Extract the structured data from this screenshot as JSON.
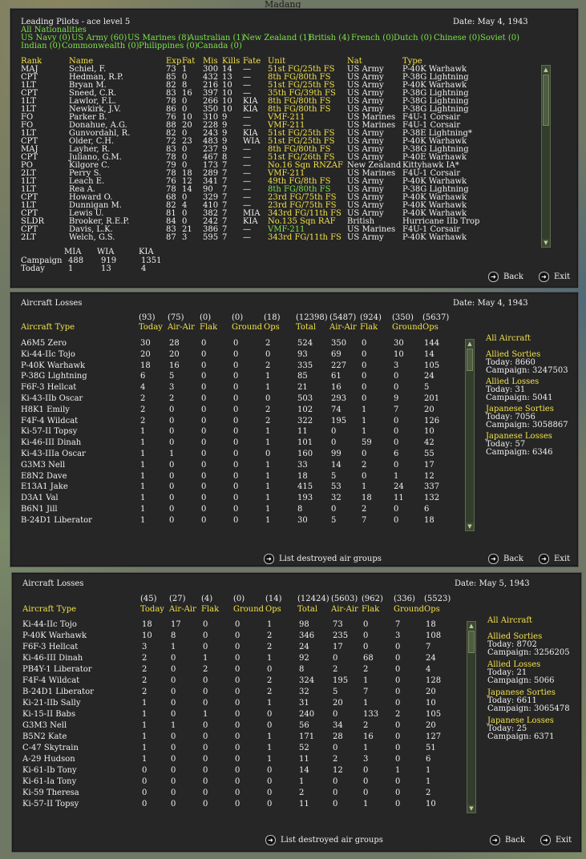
{
  "map_label": "Madang",
  "pilots": {
    "title": "Leading Pilots - ace level 5",
    "date": "Date: May 4, 1943",
    "all_nat": "All Nationalities",
    "filters1": [
      "US Navy (0)",
      "US Army (60)",
      "US Marines (8)",
      "Australian (1)",
      "New Zealand (1)",
      "British (4)",
      "French (0)",
      "Dutch (0)",
      "Chinese (0)",
      "Soviet (0)"
    ],
    "filters2": [
      "Indian (0)",
      "Commonwealth (0)",
      "Philippines (0)",
      "Canada (0)"
    ],
    "headers": [
      "Rank",
      "Name",
      "Exp",
      "Fat",
      "Mis",
      "Kills",
      "Fate",
      "Unit",
      "Nat",
      "Type"
    ],
    "rows": [
      [
        "MAJ",
        "Schiel, F.",
        "73",
        "1",
        "300",
        "14",
        "—",
        "51st FG/25th FS",
        "US Army",
        "P-40K Warhawk",
        "y"
      ],
      [
        "CPT",
        "Hedman, R.P.",
        "85",
        "0",
        "432",
        "13",
        "—",
        "8th FG/80th FS",
        "US Army",
        "P-38G Lightning",
        "y"
      ],
      [
        "1LT",
        "Bryan M.",
        "82",
        "8",
        "216",
        "10",
        "—",
        "51st FG/25th FS",
        "US Army",
        "P-40K Warhawk",
        "y"
      ],
      [
        "CPT",
        "Sneed, C.R.",
        "83",
        "16",
        "397",
        "10",
        "—",
        "35th FG/39th FS",
        "US Army",
        "P-38G Lightning",
        "y"
      ],
      [
        "1LT",
        "Lawlor, F.L.",
        "78",
        "0",
        "266",
        "10",
        "KIA",
        "8th FG/80th FS",
        "US Army",
        "P-38G Lightning",
        "y"
      ],
      [
        "1LT",
        "Newkirk, J.V.",
        "86",
        "0",
        "350",
        "10",
        "KIA",
        "8th FG/80th FS",
        "US Army",
        "P-38G Lightning",
        "y"
      ],
      [
        "FO",
        "Parker B.",
        "76",
        "10",
        "310",
        "9",
        "—",
        "VMF-211",
        "US Marines",
        "F4U-1 Corsair",
        "y"
      ],
      [
        "FO",
        "Donahue, A.G.",
        "88",
        "20",
        "228",
        "9",
        "—",
        "VMF-211",
        "US Marines",
        "F4U-1 Corsair",
        "y"
      ],
      [
        "1LT",
        "Gunvordahl, R.",
        "82",
        "0",
        "243",
        "9",
        "KIA",
        "51st FG/25th FS",
        "US Army",
        "P-38E Lightning*",
        "y"
      ],
      [
        "CPT",
        "Older, C.H.",
        "72",
        "23",
        "483",
        "9",
        "WIA",
        "51st FG/25th FS",
        "US Army",
        "P-40K Warhawk",
        "y"
      ],
      [
        "MAJ",
        "Layher, R.",
        "83",
        "0",
        "237",
        "9",
        "—",
        "8th FG/80th FS",
        "US Army",
        "P-38G Lightning",
        "y"
      ],
      [
        "CPT",
        "Juliano, G.M.",
        "78",
        "0",
        "467",
        "8",
        "—",
        "51st FG/26th FS",
        "US Army",
        "P-40E Warhawk",
        "y"
      ],
      [
        "PO",
        "Kilgore C.",
        "79",
        "0",
        "173",
        "7",
        "—",
        "No.16 Sqn RNZAF",
        "New Zealand",
        "Kittyhawk IA*",
        "y"
      ],
      [
        "2LT",
        "Perry S.",
        "78",
        "18",
        "289",
        "7",
        "—",
        "VMF-211",
        "US Marines",
        "F4U-1 Corsair",
        "y"
      ],
      [
        "1LT",
        "Leach E.",
        "76",
        "12",
        "341",
        "7",
        "—",
        "49th FG/8th FS",
        "US Army",
        "P-40K Warhawk",
        "y"
      ],
      [
        "1LT",
        "Rea A.",
        "78",
        "14",
        "90",
        "7",
        "—",
        "8th FG/80th FS",
        "US Army",
        "P-38G Lightning",
        "g"
      ],
      [
        "CPT",
        "Howard O.",
        "68",
        "0",
        "329",
        "7",
        "—",
        "23rd FG/75th FS",
        "US Army",
        "P-40K Warhawk",
        "y"
      ],
      [
        "1LT",
        "Dunnigan M.",
        "82",
        "4",
        "410",
        "7",
        "—",
        "23rd FG/75th FS",
        "US Army",
        "P-40K Warhawk",
        "y"
      ],
      [
        "CPT",
        "Lewis U.",
        "81",
        "0",
        "382",
        "7",
        "MIA",
        "343rd FG/11th FS",
        "US Army",
        "P-40K Warhawk",
        "y"
      ],
      [
        "SLDR",
        "Brooker, R.E.P.",
        "84",
        "0",
        "242",
        "7",
        "KIA",
        "No.135 Sqn RAF",
        "British",
        "Hurricane IIb Trop",
        "y"
      ],
      [
        "CPT",
        "Davis, L.K.",
        "83",
        "21",
        "386",
        "7",
        "—",
        "VMF-211",
        "US Marines",
        "F4U-1 Corsair",
        "g"
      ],
      [
        "2LT",
        "Welch, G.S.",
        "87",
        "3",
        "595",
        "7",
        "—",
        "343rd FG/11th FS",
        "US Army",
        "P-40K Warhawk",
        "y"
      ]
    ],
    "summary_headers": [
      "MIA",
      "WIA",
      "KIA"
    ],
    "summary_rows": [
      [
        "Campaign",
        "488",
        "919",
        "1351"
      ],
      [
        "Today",
        "1",
        "13",
        "4"
      ]
    ],
    "back": "Back",
    "exit": "Exit"
  },
  "losses1": {
    "title": "Aircraft Losses",
    "date": "Date: May 4, 1943",
    "totals": [
      "(93)",
      "(75)",
      "(0)",
      "(0)",
      "(18)",
      "(12398)",
      "(5487)",
      "(924)",
      "(350)",
      "(5637)"
    ],
    "type_header": "Aircraft Type",
    "headers": [
      "Today",
      "Air-Air",
      "Flak",
      "Ground",
      "Ops",
      "Total",
      "Air-Air",
      "Flak",
      "Ground",
      "Ops"
    ],
    "rows": [
      [
        "A6M5 Zero",
        "30",
        "28",
        "0",
        "0",
        "2",
        "524",
        "350",
        "0",
        "30",
        "144"
      ],
      [
        "Ki-44-IIc Tojo",
        "20",
        "20",
        "0",
        "0",
        "0",
        "93",
        "69",
        "0",
        "10",
        "14"
      ],
      [
        "P-40K Warhawk",
        "18",
        "16",
        "0",
        "0",
        "2",
        "335",
        "227",
        "0",
        "3",
        "105"
      ],
      [
        "P-38G Lightning",
        "6",
        "5",
        "0",
        "0",
        "1",
        "85",
        "61",
        "0",
        "0",
        "24"
      ],
      [
        "F6F-3 Hellcat",
        "4",
        "3",
        "0",
        "0",
        "1",
        "21",
        "16",
        "0",
        "0",
        "5"
      ],
      [
        "Ki-43-IIb Oscar",
        "2",
        "2",
        "0",
        "0",
        "0",
        "503",
        "293",
        "0",
        "9",
        "201"
      ],
      [
        "H8K1 Emily",
        "2",
        "0",
        "0",
        "0",
        "2",
        "102",
        "74",
        "1",
        "7",
        "20"
      ],
      [
        "F4F-4 Wildcat",
        "2",
        "0",
        "0",
        "0",
        "2",
        "322",
        "195",
        "1",
        "0",
        "126"
      ],
      [
        "Ki-57-II Topsy",
        "1",
        "0",
        "0",
        "0",
        "1",
        "11",
        "0",
        "1",
        "0",
        "10"
      ],
      [
        "Ki-46-III Dinah",
        "1",
        "0",
        "0",
        "0",
        "1",
        "101",
        "0",
        "59",
        "0",
        "42"
      ],
      [
        "Ki-43-IIIa Oscar",
        "1",
        "1",
        "0",
        "0",
        "0",
        "160",
        "99",
        "0",
        "6",
        "55"
      ],
      [
        "G3M3 Nell",
        "1",
        "0",
        "0",
        "0",
        "1",
        "33",
        "14",
        "2",
        "0",
        "17"
      ],
      [
        "E8N2 Dave",
        "1",
        "0",
        "0",
        "0",
        "1",
        "18",
        "5",
        "0",
        "1",
        "12"
      ],
      [
        "E13A1 Jake",
        "1",
        "0",
        "0",
        "0",
        "1",
        "415",
        "53",
        "1",
        "24",
        "337"
      ],
      [
        "D3A1 Val",
        "1",
        "0",
        "0",
        "0",
        "1",
        "193",
        "32",
        "18",
        "11",
        "132"
      ],
      [
        "B6N1 Jill",
        "1",
        "0",
        "0",
        "0",
        "1",
        "8",
        "0",
        "2",
        "0",
        "6"
      ],
      [
        "B-24D1 Liberator",
        "1",
        "0",
        "0",
        "0",
        "1",
        "30",
        "5",
        "7",
        "0",
        "18"
      ]
    ],
    "side": {
      "all": "All Aircraft",
      "blocks": [
        [
          "Allied Sorties",
          "Today:  8660",
          "Campaign: 3247503"
        ],
        [
          "Allied Losses",
          "Today:  31",
          "Campaign: 5041"
        ],
        [
          "Japanese Sorties",
          "Today:  7056",
          "Campaign: 3058867"
        ],
        [
          "Japanese Losses",
          "Today:  57",
          "Campaign: 6346"
        ]
      ]
    },
    "list_destroyed": "List destroyed air groups",
    "back": "Back",
    "exit": "Exit"
  },
  "losses2": {
    "title": "Aircraft Losses",
    "date": "Date: May 5, 1943",
    "totals": [
      "(45)",
      "(27)",
      "(4)",
      "(0)",
      "(14)",
      "(12424)",
      "(5603)",
      "(962)",
      "(336)",
      "(5523)"
    ],
    "type_header": "Aircraft Type",
    "headers": [
      "Today",
      "Air-Air",
      "Flak",
      "Ground",
      "Ops",
      "Total",
      "Air-Air",
      "Flak",
      "Ground",
      "Ops"
    ],
    "rows": [
      [
        "Ki-44-IIc Tojo",
        "18",
        "17",
        "0",
        "0",
        "1",
        "98",
        "73",
        "0",
        "7",
        "18"
      ],
      [
        "P-40K Warhawk",
        "10",
        "8",
        "0",
        "0",
        "2",
        "346",
        "235",
        "0",
        "3",
        "108"
      ],
      [
        "F6F-3 Hellcat",
        "3",
        "1",
        "0",
        "0",
        "2",
        "24",
        "17",
        "0",
        "0",
        "7"
      ],
      [
        "Ki-46-III Dinah",
        "2",
        "0",
        "1",
        "0",
        "1",
        "92",
        "0",
        "68",
        "0",
        "24"
      ],
      [
        "PB4Y-1 Liberator",
        "2",
        "0",
        "2",
        "0",
        "0",
        "8",
        "2",
        "2",
        "0",
        "4"
      ],
      [
        "F4F-4 Wildcat",
        "2",
        "0",
        "0",
        "0",
        "2",
        "324",
        "195",
        "1",
        "0",
        "128"
      ],
      [
        "B-24D1 Liberator",
        "2",
        "0",
        "0",
        "0",
        "2",
        "32",
        "5",
        "7",
        "0",
        "20"
      ],
      [
        "Ki-21-IIb Sally",
        "1",
        "0",
        "0",
        "0",
        "1",
        "31",
        "20",
        "1",
        "0",
        "10"
      ],
      [
        "Ki-15-II Babs",
        "1",
        "0",
        "1",
        "0",
        "0",
        "240",
        "0",
        "133",
        "2",
        "105"
      ],
      [
        "G3M3 Nell",
        "1",
        "1",
        "0",
        "0",
        "0",
        "56",
        "34",
        "2",
        "0",
        "20"
      ],
      [
        "B5N2 Kate",
        "1",
        "0",
        "0",
        "0",
        "1",
        "171",
        "28",
        "16",
        "0",
        "127"
      ],
      [
        "C-47 Skytrain",
        "1",
        "0",
        "0",
        "0",
        "1",
        "52",
        "0",
        "1",
        "0",
        "51"
      ],
      [
        "A-29 Hudson",
        "1",
        "0",
        "0",
        "0",
        "1",
        "11",
        "2",
        "3",
        "0",
        "6"
      ],
      [
        "Ki-61-Ib Tony",
        "0",
        "0",
        "0",
        "0",
        "0",
        "14",
        "12",
        "0",
        "1",
        "1"
      ],
      [
        "Ki-61-Ia Tony",
        "0",
        "0",
        "0",
        "0",
        "0",
        "1",
        "0",
        "0",
        "0",
        "1"
      ],
      [
        "Ki-59 Theresa",
        "0",
        "0",
        "0",
        "0",
        "0",
        "2",
        "0",
        "0",
        "0",
        "2"
      ],
      [
        "Ki-57-II Topsy",
        "0",
        "0",
        "0",
        "0",
        "0",
        "11",
        "0",
        "1",
        "0",
        "10"
      ]
    ],
    "side": {
      "all": "All Aircraft",
      "blocks": [
        [
          "Allied Sorties",
          "Today:  8702",
          "Campaign: 3256205"
        ],
        [
          "Allied Losses",
          "Today:  21",
          "Campaign: 5066"
        ],
        [
          "Japanese Sorties",
          "Today:  6611",
          "Campaign: 3065478"
        ],
        [
          "Japanese Losses",
          "Today:  25",
          "Campaign: 6371"
        ]
      ]
    },
    "list_destroyed": "List destroyed air groups",
    "back": "Back",
    "exit": "Exit"
  }
}
